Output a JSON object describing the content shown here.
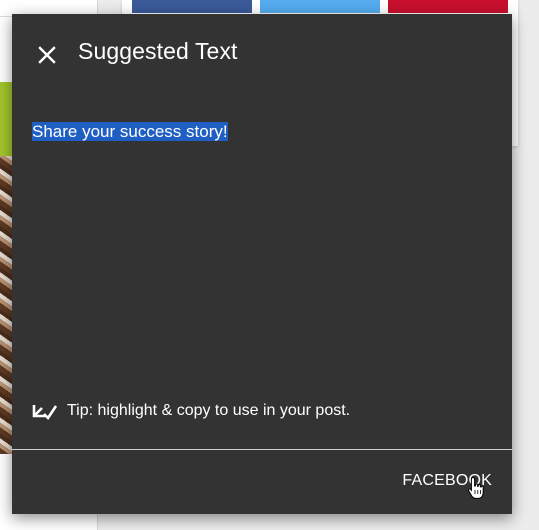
{
  "dialog": {
    "title": "Suggested Text",
    "suggested_text": "Share your success story!",
    "tip": "Tip: highlight & copy to use in your post.",
    "action_label": "FACEBOOK"
  },
  "icons": {
    "close": "close-icon",
    "tip": "check-arrow-icon",
    "cursor": "hand-pointer-cursor"
  },
  "colors": {
    "dialog_bg": "#333333",
    "selection": "#1f5fc4",
    "facebook": "#3b5a98",
    "twitter": "#55acee",
    "pinterest": "#c8102e",
    "accent_green": "#a2c62a"
  }
}
